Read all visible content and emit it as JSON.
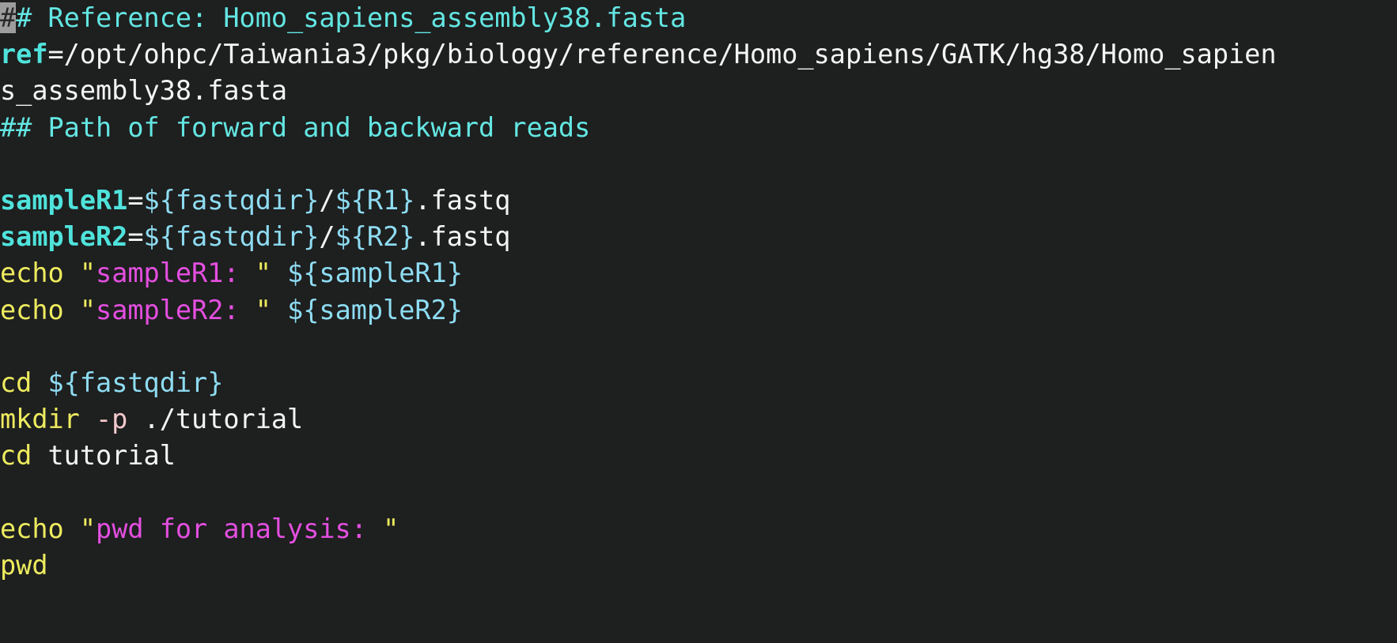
{
  "terminal": {
    "background_color": "#1e1f1f",
    "default_text_color": "#f2f2f2",
    "cursor": {
      "style": "block",
      "color": "#9d9d9d",
      "on_character": "#",
      "line": 1,
      "column": 1
    },
    "palette": {
      "comment": "#63e6e2",
      "variable_definition": "#4fe3dc",
      "builtin": "#edeb5e",
      "quote": "#edeb5e",
      "string": "#e44fe0",
      "expansion": "#8edcf2",
      "flag": "#f2c9cb",
      "plain": "#f4f4f4"
    }
  },
  "script": {
    "language": "bash",
    "lines": [
      {
        "index": 1,
        "type": "comment",
        "text": "## Reference: Homo_sapiens_assembly38.fasta",
        "tokens": [
          {
            "t": "#",
            "k": "comment",
            "cursor": true
          },
          {
            "t": "# Reference: Homo_sapiens_assembly38.fasta",
            "k": "comment"
          }
        ]
      },
      {
        "index": 2,
        "type": "assignment",
        "text": "ref=/opt/ohpc/Taiwania3/pkg/biology/reference/Homo_sapiens/GATK/hg38/Homo_sapiens_assembly38.fasta",
        "wrapped": true,
        "tokens": [
          {
            "t": "ref",
            "k": "var-def"
          },
          {
            "t": "=/opt/ohpc/Taiwania3/pkg/biology/reference/Homo_sapiens/GATK/hg38/Homo_sapien",
            "k": "plain"
          }
        ]
      },
      {
        "index": 3,
        "type": "wrap-continuation",
        "text": "s_assembly38.fasta",
        "tokens": [
          {
            "t": "s_assembly38.fasta",
            "k": "plain"
          }
        ]
      },
      {
        "index": 4,
        "type": "comment",
        "text": "## Path of forward and backward reads",
        "tokens": [
          {
            "t": "## Path of forward and backward reads",
            "k": "comment"
          }
        ]
      },
      {
        "index": 5,
        "type": "blank",
        "text": "",
        "tokens": []
      },
      {
        "index": 6,
        "type": "assignment",
        "text": "sampleR1=${fastqdir}/${R1}.fastq",
        "tokens": [
          {
            "t": "sampleR1",
            "k": "var-def"
          },
          {
            "t": "=",
            "k": "op"
          },
          {
            "t": "${fastqdir}",
            "k": "expansion"
          },
          {
            "t": "/",
            "k": "plain"
          },
          {
            "t": "${R1}",
            "k": "expansion"
          },
          {
            "t": ".fastq",
            "k": "plain"
          }
        ]
      },
      {
        "index": 7,
        "type": "assignment",
        "text": "sampleR2=${fastqdir}/${R2}.fastq",
        "tokens": [
          {
            "t": "sampleR2",
            "k": "var-def"
          },
          {
            "t": "=",
            "k": "op"
          },
          {
            "t": "${fastqdir}",
            "k": "expansion"
          },
          {
            "t": "/",
            "k": "plain"
          },
          {
            "t": "${R2}",
            "k": "expansion"
          },
          {
            "t": ".fastq",
            "k": "plain"
          }
        ]
      },
      {
        "index": 8,
        "type": "command",
        "text": "echo \"sampleR1: \" ${sampleR1}",
        "tokens": [
          {
            "t": "echo",
            "k": "builtin"
          },
          {
            "t": " ",
            "k": "plain"
          },
          {
            "t": "\"",
            "k": "quote"
          },
          {
            "t": "sampleR1: ",
            "k": "string"
          },
          {
            "t": "\"",
            "k": "quote"
          },
          {
            "t": " ",
            "k": "plain"
          },
          {
            "t": "${sampleR1}",
            "k": "expansion"
          }
        ]
      },
      {
        "index": 9,
        "type": "command",
        "text": "echo \"sampleR2: \" ${sampleR2}",
        "tokens": [
          {
            "t": "echo",
            "k": "builtin"
          },
          {
            "t": " ",
            "k": "plain"
          },
          {
            "t": "\"",
            "k": "quote"
          },
          {
            "t": "sampleR2: ",
            "k": "string"
          },
          {
            "t": "\"",
            "k": "quote"
          },
          {
            "t": " ",
            "k": "plain"
          },
          {
            "t": "${sampleR2}",
            "k": "expansion"
          }
        ]
      },
      {
        "index": 10,
        "type": "blank",
        "text": "",
        "tokens": []
      },
      {
        "index": 11,
        "type": "command",
        "text": "cd ${fastqdir}",
        "tokens": [
          {
            "t": "cd",
            "k": "builtin"
          },
          {
            "t": " ",
            "k": "plain"
          },
          {
            "t": "${fastqdir}",
            "k": "expansion"
          }
        ]
      },
      {
        "index": 12,
        "type": "command",
        "text": "mkdir -p ./tutorial",
        "tokens": [
          {
            "t": "mkdir",
            "k": "builtin"
          },
          {
            "t": " ",
            "k": "plain"
          },
          {
            "t": "-p",
            "k": "flag"
          },
          {
            "t": " ./tutorial",
            "k": "plain"
          }
        ]
      },
      {
        "index": 13,
        "type": "command",
        "text": "cd tutorial",
        "tokens": [
          {
            "t": "cd",
            "k": "builtin"
          },
          {
            "t": " tutorial",
            "k": "plain"
          }
        ]
      },
      {
        "index": 14,
        "type": "blank",
        "text": "",
        "tokens": []
      },
      {
        "index": 15,
        "type": "command",
        "text": "echo \"pwd for analysis: \"",
        "tokens": [
          {
            "t": "echo",
            "k": "builtin"
          },
          {
            "t": " ",
            "k": "plain"
          },
          {
            "t": "\"",
            "k": "quote"
          },
          {
            "t": "pwd for analysis: ",
            "k": "string"
          },
          {
            "t": "\"",
            "k": "quote"
          }
        ]
      },
      {
        "index": 16,
        "type": "command",
        "text": "pwd",
        "tokens": [
          {
            "t": "pwd",
            "k": "builtin"
          }
        ]
      }
    ]
  }
}
